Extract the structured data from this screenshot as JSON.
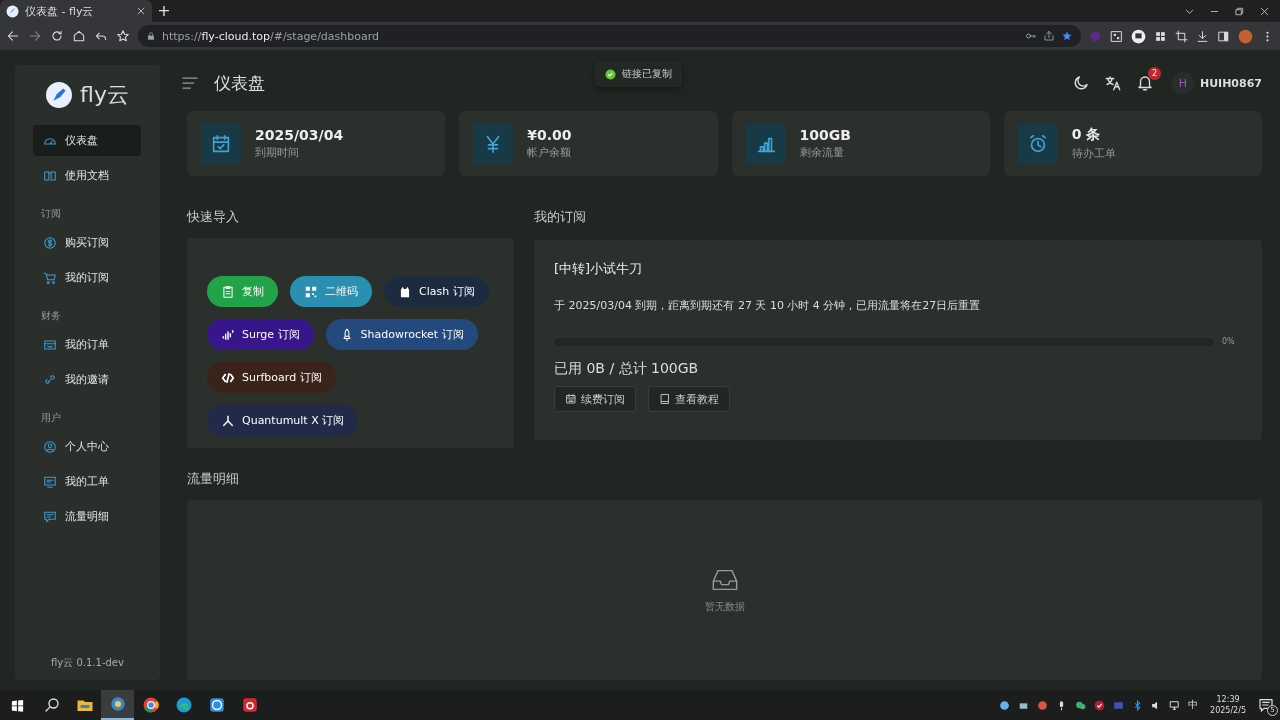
{
  "browser": {
    "tab_title": "仪表盘 - fly云",
    "new_tab": "+",
    "url_scheme": "https://",
    "url_host": "fly-cloud.top",
    "url_path": "/#/stage/dashboard"
  },
  "sidebar": {
    "logo": "fly云",
    "items": [
      {
        "kind": "item",
        "label": "仪表盘",
        "selected": true
      },
      {
        "kind": "item",
        "label": "使用文档",
        "selected": false
      },
      {
        "kind": "group",
        "label": "订阅"
      },
      {
        "kind": "item",
        "label": "购买订阅",
        "selected": false
      },
      {
        "kind": "item",
        "label": "我的订阅",
        "selected": false
      },
      {
        "kind": "group",
        "label": "财务"
      },
      {
        "kind": "item",
        "label": "我的订单",
        "selected": false
      },
      {
        "kind": "item",
        "label": "我的邀请",
        "selected": false
      },
      {
        "kind": "group",
        "label": "用户"
      },
      {
        "kind": "item",
        "label": "个人中心",
        "selected": false
      },
      {
        "kind": "item",
        "label": "我的工单",
        "selected": false
      },
      {
        "kind": "item",
        "label": "流量明细",
        "selected": false
      }
    ],
    "version": "fly云 0.1.1-dev"
  },
  "header": {
    "title": "仪表盘",
    "toast": "链接已复制",
    "notification_count": "2",
    "avatar_letter": "H",
    "username": "HUIH0867"
  },
  "stats": [
    {
      "value": "2025/03/04",
      "label": "到期时间"
    },
    {
      "value": "¥0.00",
      "label": "帐户余额"
    },
    {
      "value": "100GB",
      "label": "剩余流量"
    },
    {
      "value": "0 条",
      "label": "待办工单"
    }
  ],
  "quick_import": {
    "title": "快速导入",
    "buttons": [
      {
        "label": "复制",
        "color": "#22a34a"
      },
      {
        "label": "二维码",
        "color": "#2a8fb0"
      },
      {
        "label": "Clash 订阅",
        "color": "#1c2b40"
      },
      {
        "label": "Surge 订阅",
        "color": "#36168a"
      },
      {
        "label": "Shadowrocket 订阅",
        "color": "#23497e"
      },
      {
        "label": "Surfboard 订阅",
        "color": "#3a2419"
      },
      {
        "label": "Quantumult X 订阅",
        "color": "#222a4a"
      }
    ]
  },
  "subscription": {
    "title": "我的订阅",
    "plan": "[中转]小试牛刀",
    "expiry_text": "于 2025/03/04 到期，距离到期还有 27 天 10 小时 4 分钟，已用流量将在27日后重置",
    "level": 0,
    "percent": "0%",
    "usage": "已用 0B / 总计 100GB",
    "buttons": [
      "续费订阅",
      "查看教程"
    ]
  },
  "traffic": {
    "title": "流量明细",
    "empty_text": "暂无数据"
  },
  "taskbar": {
    "apps": [
      {
        "selected": false
      },
      {
        "selected": false
      },
      {
        "selected": true
      },
      {
        "selected": false
      },
      {
        "selected": false
      },
      {
        "selected": false
      },
      {
        "selected": false
      }
    ],
    "ime": "中",
    "time": "12:39",
    "date": "2025/2/5",
    "notification_count": "5"
  }
}
